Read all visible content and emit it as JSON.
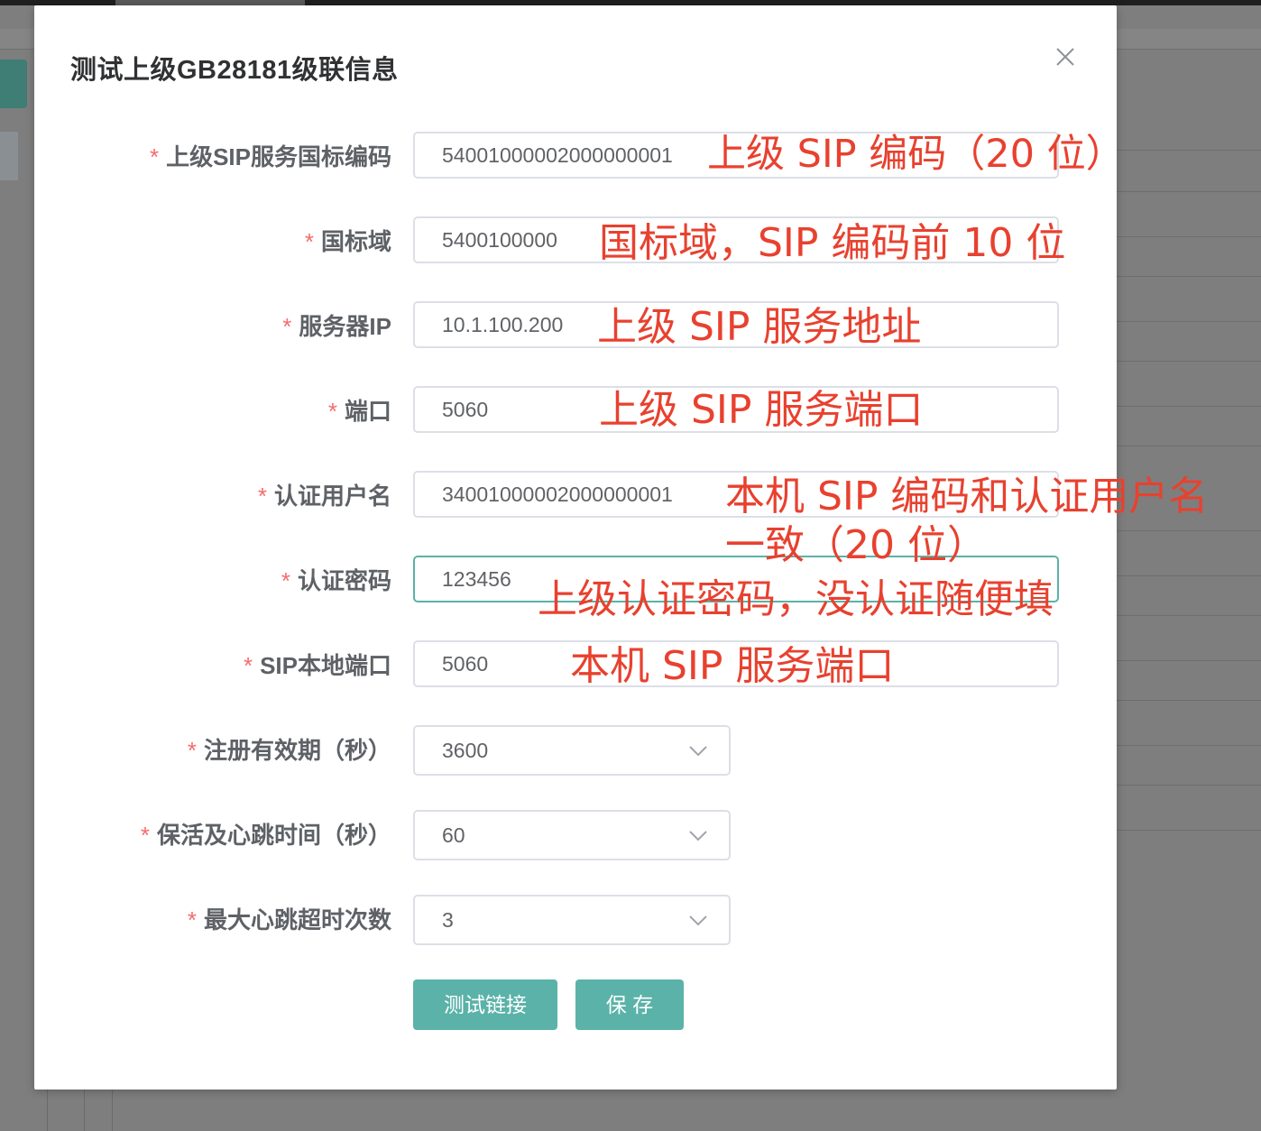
{
  "dialog": {
    "title": "测试上级GB28181级联信息"
  },
  "form": {
    "required_mark": "*",
    "fields": [
      {
        "label": "上级SIP服务国标编码",
        "value": "54001000002000000001"
      },
      {
        "label": "国标域",
        "value": "5400100000"
      },
      {
        "label": "服务器IP",
        "value": "10.1.100.200"
      },
      {
        "label": "端口",
        "value": "5060"
      },
      {
        "label": "认证用户名",
        "value": "34001000002000000001"
      },
      {
        "label": "认证密码",
        "value": "123456"
      },
      {
        "label": "SIP本地端口",
        "value": "5060"
      }
    ],
    "selects": [
      {
        "label": "注册有效期（秒）",
        "value": "3600"
      },
      {
        "label": "保活及心跳时间（秒）",
        "value": "60"
      },
      {
        "label": "最大心跳超时次数",
        "value": "3"
      }
    ]
  },
  "buttons": {
    "test_label": "测试链接",
    "save_label": "保 存"
  },
  "annotations": [
    "上级 SIP 编码（20 位）",
    "国标域，SIP 编码前 10 位",
    "上级 SIP 服务地址",
    "上级 SIP 服务端口",
    "本机 SIP 编码和认证用户名",
    "一致（20 位）",
    "上级认证密码，没认证随便填",
    "本机 SIP 服务端口"
  ],
  "colors": {
    "accent": "#5bb2a8",
    "annotation": "#e8412f",
    "required": "#f56c6c"
  }
}
